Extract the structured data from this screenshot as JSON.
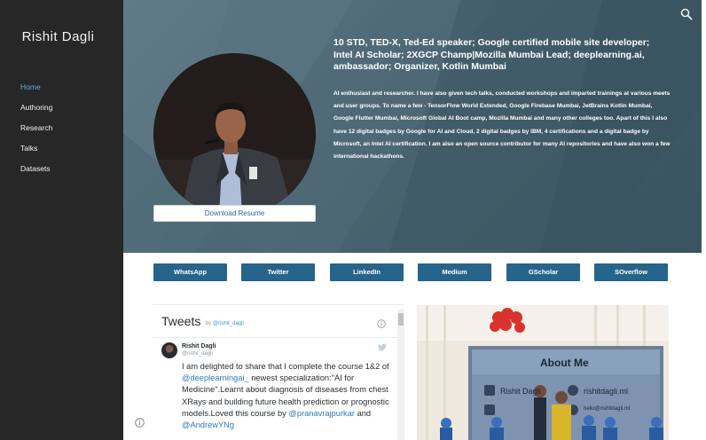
{
  "sidebar": {
    "brand": "Rishit Dagli",
    "nav": [
      {
        "label": "Home",
        "active": true
      },
      {
        "label": "Authoring",
        "active": false
      },
      {
        "label": "Research",
        "active": false
      },
      {
        "label": "Talks",
        "active": false
      },
      {
        "label": "Datasets",
        "active": false
      }
    ]
  },
  "header": {
    "search_icon": "search-icon"
  },
  "hero": {
    "headline": "10 STD, TED-X, Ted-Ed speaker; Google certified mobile site developer; Intel AI Scholar; 2XGCP Champ|Mozilla Mumbai Lead; deeplearning.ai, ambassador; Organizer, Kotlin Mumbai",
    "bio": "AI enthusiast and researcher. I have also given tech talks, conducted workshops and imparted trainings at various meets and user groups. To name a few - TensorFlow World Extended, Google Firebase Mumbai, JetBrains Kotlin Mumbai, Google Flutter Mumbai, Microsoft Global AI Boot camp, Mozilla Mumbai and many other colleges too. Apart of this I also have 12 digital badges by Google for AI and Cloud, 2 digital badges by IBM, 4 certifications and a digital badge by Microsoft, an Intel AI certification. I am also an open source contributor for many AI repositories and have also won a few international hackathons.",
    "resume_button": "Download Resume"
  },
  "social": [
    "WhatsApp",
    "Twitter",
    "LinkedIn",
    "Medium",
    "GScholar",
    "SOverflow"
  ],
  "tweets": {
    "title": "Tweets",
    "by_prefix": "by",
    "by_handle": "@rishit_dagli",
    "tweet": {
      "name": "Rishit Dagli",
      "handle": "@rishit_dagli",
      "text_1": "I am delighted to share that I complete the course 1&2 of",
      "mention_1": "@deeplearningai_",
      "text_2": "newest specialization:\"AI for Medicine\".Learnt about diagnosis of diseases from chest XRays and building future health prediction or prognostic models.Loved this course by",
      "mention_2": "@pranavrajpurkar",
      "text_3": "and",
      "mention_3": "@AndrewYNg"
    }
  },
  "photo": {
    "screen_title": "About Me",
    "screen_name": "Rishit Dagli",
    "screen_url": "rishitdagli.ml",
    "screen_email": "hello@rishitdagli.ml"
  },
  "colors": {
    "sidebar": "#272727",
    "nav_active": "#5fb0e0",
    "hero": "#4a6471",
    "social_button": "#26648b"
  }
}
